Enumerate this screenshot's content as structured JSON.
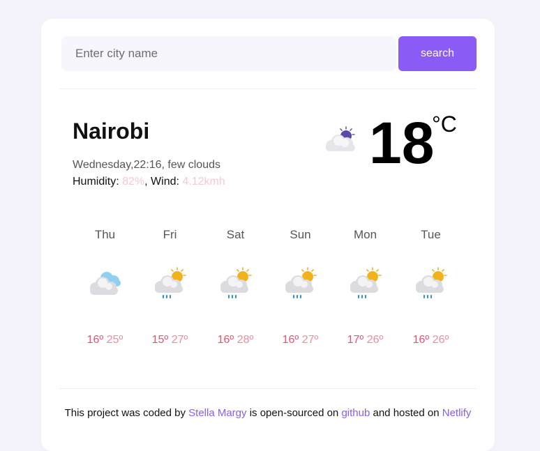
{
  "search": {
    "placeholder": "Enter city name",
    "button_label": "search"
  },
  "current": {
    "city": "Nairobi",
    "description": "Wednesday,22:16, few clouds",
    "humidity_label": "Humidity: ",
    "humidity_value": "82%",
    "wind_label": ", Wind: ",
    "wind_value": "4.12kmh",
    "temperature": "18",
    "unit": "°C",
    "icon": "few-clouds-night-icon"
  },
  "forecast": [
    {
      "day": "Thu",
      "min": "16º",
      "max": "25º",
      "icon": "clouds-icon"
    },
    {
      "day": "Fri",
      "min": "15º",
      "max": "27º",
      "icon": "rain-sun-icon"
    },
    {
      "day": "Sat",
      "min": "16º",
      "max": "28º",
      "icon": "rain-sun-icon"
    },
    {
      "day": "Sun",
      "min": "16º",
      "max": "27º",
      "icon": "rain-sun-icon"
    },
    {
      "day": "Mon",
      "min": "17º",
      "max": "26º",
      "icon": "rain-sun-icon"
    },
    {
      "day": "Tue",
      "min": "16º",
      "max": "26º",
      "icon": "rain-sun-icon"
    }
  ],
  "footer": {
    "text1": "This project was coded by ",
    "author": "Stella Margy",
    "text2": " is open-sourced on ",
    "github": "github",
    "text3": " and hosted on ",
    "netlify": "Netlify"
  },
  "colors": {
    "accent": "#8a5cf5",
    "temp_min": "#e3546e",
    "temp_max": "#ee8d9c",
    "faint_value": "#f8c9cf"
  }
}
